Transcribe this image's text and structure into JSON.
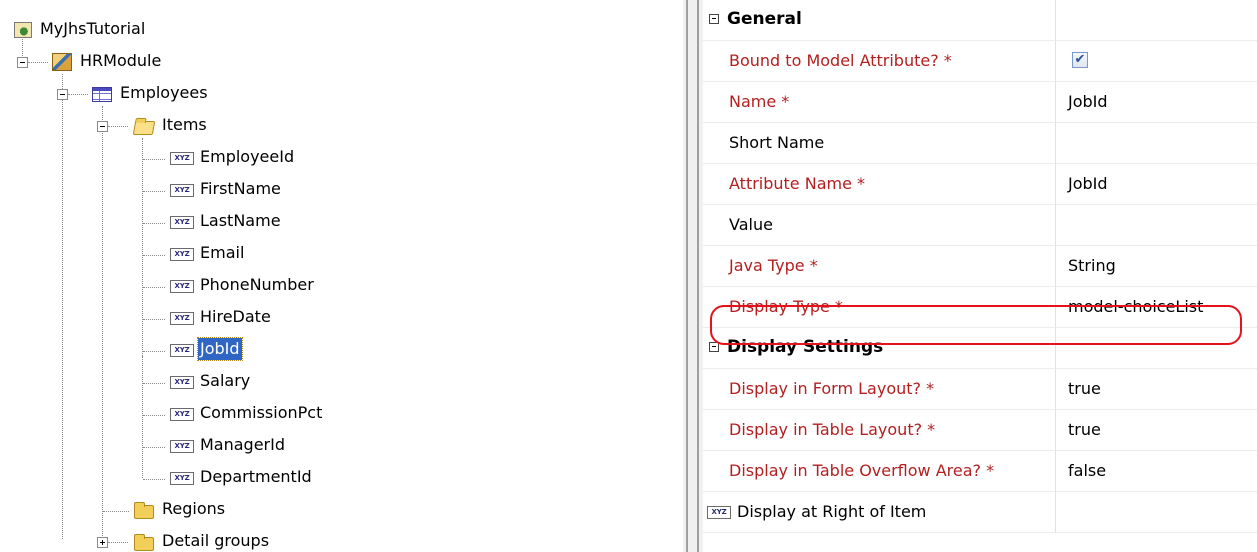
{
  "tree": {
    "application": "MyJhsTutorial",
    "module": "HRModule",
    "group": "Employees",
    "items_folder": "Items",
    "items": [
      "EmployeeId",
      "FirstName",
      "LastName",
      "Email",
      "PhoneNumber",
      "HireDate",
      "JobId",
      "Salary",
      "CommissionPct",
      "ManagerId",
      "DepartmentId"
    ],
    "selected_item": "JobId",
    "regions_folder": "Regions",
    "detail_groups_folder": "Detail groups"
  },
  "properties": {
    "general_category": "General",
    "bound": {
      "label": "Bound to Model Attribute? *",
      "checked": true,
      "check_glyph": "✔"
    },
    "name": {
      "label": "Name *",
      "value": "JobId"
    },
    "short_name": {
      "label": "Short Name",
      "value": ""
    },
    "attribute_name": {
      "label": "Attribute Name *",
      "value": "JobId"
    },
    "value": {
      "label": "Value",
      "value": ""
    },
    "java_type": {
      "label": "Java Type *",
      "value": "String"
    },
    "display_type": {
      "label": "Display Type *",
      "value": "model-choiceList"
    },
    "display_settings_category": "Display Settings",
    "display_in_form": {
      "label": "Display in Form Layout? *",
      "value": "true"
    },
    "display_in_table": {
      "label": "Display in Table Layout? *",
      "value": "true"
    },
    "display_in_overflow": {
      "label": "Display in Table Overflow Area? *",
      "value": "false"
    },
    "display_at_right": {
      "label": "Display at Right of Item",
      "value": ""
    }
  },
  "colors": {
    "required_label": "#b22020",
    "selection": "#2f65c3",
    "highlight_ring": "#e4131b"
  }
}
